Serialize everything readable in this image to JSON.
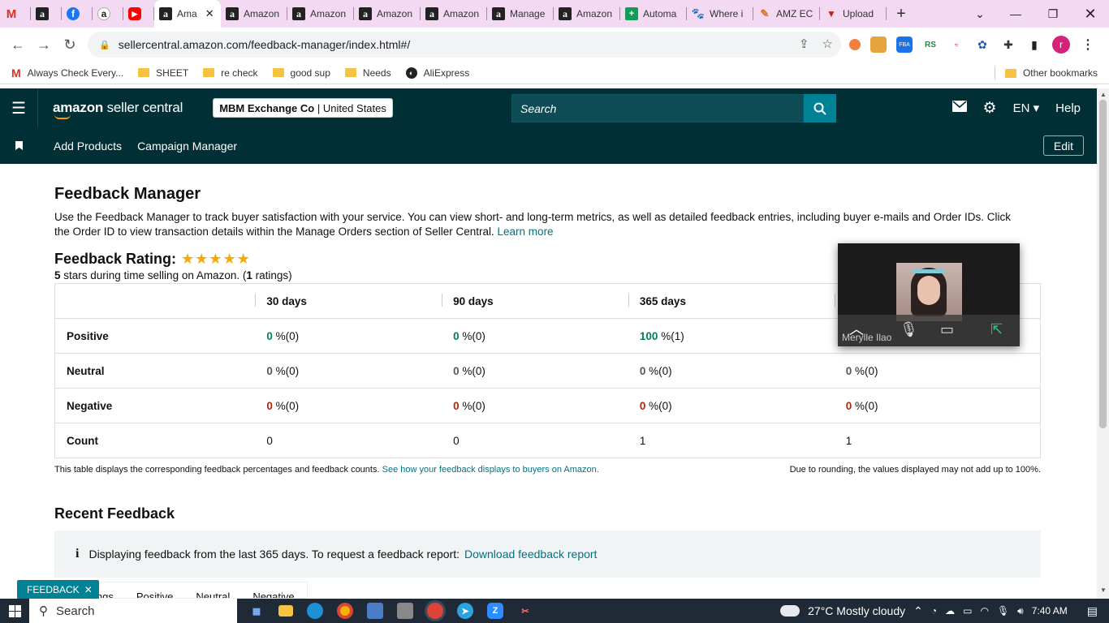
{
  "browser": {
    "tabs": [
      {
        "label": "",
        "icon": "gmail-icon",
        "glyph": "M",
        "cls": "gm"
      },
      {
        "label": "",
        "icon": "amazon-icon",
        "glyph": "a",
        "cls": "amz"
      },
      {
        "label": "",
        "icon": "facebook-icon",
        "glyph": "f",
        "cls": "fb"
      },
      {
        "label": "",
        "icon": "amazon-icon",
        "glyph": "a",
        "cls": "amz2"
      },
      {
        "label": "",
        "icon": "youtube-icon",
        "glyph": "▶",
        "cls": "yt"
      },
      {
        "label": "Ama",
        "icon": "amazon-icon",
        "glyph": "a",
        "cls": "amz",
        "active": true
      },
      {
        "label": "Amazon",
        "icon": "amazon-icon",
        "glyph": "a",
        "cls": "amz"
      },
      {
        "label": "Amazon",
        "icon": "amazon-icon",
        "glyph": "a",
        "cls": "amz"
      },
      {
        "label": "Amazon",
        "icon": "amazon-icon",
        "glyph": "a",
        "cls": "amz"
      },
      {
        "label": "Amazon",
        "icon": "amazon-icon",
        "glyph": "a",
        "cls": "amz"
      },
      {
        "label": "Manage",
        "icon": "amazon-icon",
        "glyph": "a",
        "cls": "amz"
      },
      {
        "label": "Amazon",
        "icon": "amazon-icon",
        "glyph": "a",
        "cls": "amz"
      },
      {
        "label": "Automa",
        "icon": "sheets-icon",
        "glyph": "+",
        "cls": "sheet"
      },
      {
        "label": "Where i",
        "icon": "paw-icon",
        "glyph": "🐾",
        "cls": "paw"
      },
      {
        "label": "AMZ EC",
        "icon": "pencil-icon",
        "glyph": "✎",
        "cls": "pencil"
      },
      {
        "label": "Upload",
        "icon": "triangle-icon",
        "glyph": "▼",
        "cls": "tri"
      }
    ],
    "url": "sellercentral.amazon.com/feedback-manager/index.html#/",
    "bookmarks": [
      {
        "label": "Always Check Every...",
        "icon": "gmail-icon"
      },
      {
        "label": "SHEET",
        "icon": "folder-icon"
      },
      {
        "label": "re check",
        "icon": "folder-icon"
      },
      {
        "label": "good sup",
        "icon": "folder-icon"
      },
      {
        "label": "Needs",
        "icon": "folder-icon"
      },
      {
        "label": "AliExpress",
        "icon": "globe-icon"
      }
    ],
    "other_bookmarks": "Other bookmarks",
    "profile_initial": "r"
  },
  "header": {
    "logo_bold": "amazon",
    "logo_sub": " seller central",
    "merchant": "MBM Exchange Co",
    "marketplace": "United States",
    "search_placeholder": "Search",
    "language": "EN",
    "help": "Help"
  },
  "subnav": {
    "links": [
      "Add Products",
      "Campaign Manager"
    ],
    "edit": "Edit"
  },
  "page": {
    "title": "Feedback Manager",
    "intro": "Use the Feedback Manager to track buyer satisfaction with your service. You can view short- and long-term metrics, as well as detailed feedback entries, including buyer e-mails and Order IDs. Click the Order ID to view transaction details within the Manage Orders section of Seller Central.",
    "learn_more": "Learn more",
    "rating_label": "Feedback Rating:",
    "stars": 5,
    "stars_glyphs": "★★★★★",
    "rating_count_stars": "5",
    "rating_text_mid": " stars during time selling on Amazon. (",
    "rating_count": "1",
    "rating_text_end": " ratings)"
  },
  "table": {
    "columns": [
      "",
      "30 days",
      "90 days",
      "365 days",
      ""
    ],
    "rows": [
      {
        "label": "Positive",
        "kind": "pos",
        "cells": [
          [
            "0",
            " %(0)"
          ],
          [
            "0",
            " %(0)"
          ],
          [
            "100",
            " %(1)"
          ],
          [
            "",
            ""
          ]
        ]
      },
      {
        "label": "Neutral",
        "kind": "neu",
        "cells": [
          [
            "0",
            " %(0)"
          ],
          [
            "0",
            " %(0)"
          ],
          [
            "0",
            " %(0)"
          ],
          [
            "0",
            " %(0)"
          ]
        ]
      },
      {
        "label": "Negative",
        "kind": "neg",
        "cells": [
          [
            "0",
            " %(0)"
          ],
          [
            "0",
            " %(0)"
          ],
          [
            "0",
            " %(0)"
          ],
          [
            "0",
            " %(0)"
          ]
        ]
      },
      {
        "label": "Count",
        "kind": "count",
        "cells": [
          [
            "0",
            ""
          ],
          [
            "0",
            ""
          ],
          [
            "1",
            ""
          ],
          [
            "1",
            ""
          ]
        ]
      }
    ],
    "note_left": "This table displays the corresponding feedback percentages and feedback counts.",
    "note_link": "See how your feedback displays to buyers on Amazon.",
    "note_right": "Due to rounding, the values displayed may not add up to 100%."
  },
  "recent": {
    "title": "Recent Feedback",
    "info_text": "Displaying feedback from the last 365 days. To request a feedback report:",
    "info_link": "Download feedback report",
    "sub_tabs": [
      "ings",
      "Positive",
      "Neutral",
      "Negative"
    ]
  },
  "feedback_button": "FEEDBACK",
  "video": {
    "name": "Merylle Ilao"
  },
  "taskbar": {
    "search": "Search",
    "weather": "27°C  Mostly cloudy",
    "time": "7:40 AM"
  },
  "colors": {
    "header_bg": "#002f36",
    "positive": "#067d62",
    "negative": "#b12704",
    "link": "#007185",
    "tab_strip": "#f3d9f1"
  }
}
